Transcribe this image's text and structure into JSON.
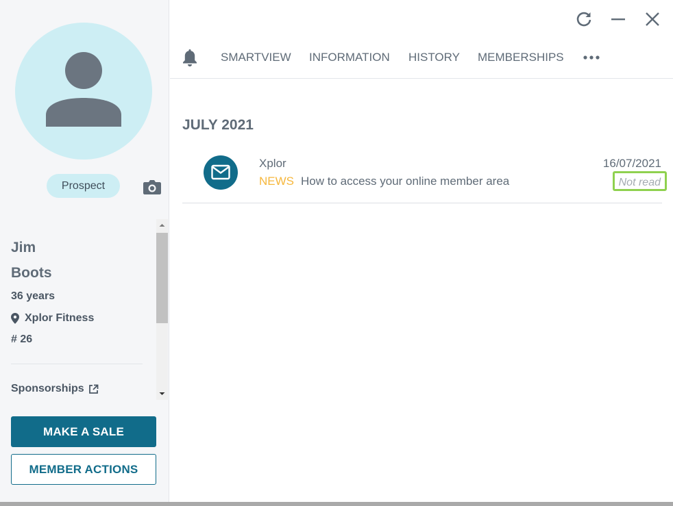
{
  "profile": {
    "status_badge": "Prospect",
    "first_name": "Jim",
    "last_name": "Boots",
    "age": "36 years",
    "location": "Xplor Fitness",
    "member_number": "# 26",
    "sponsorships_label": "Sponsorships"
  },
  "actions": {
    "make_sale": "MAKE A SALE",
    "member_actions": "MEMBER ACTIONS"
  },
  "tabs": [
    {
      "label": "SMARTVIEW"
    },
    {
      "label": "INFORMATION"
    },
    {
      "label": "HISTORY"
    },
    {
      "label": "MEMBERSHIPS"
    }
  ],
  "icons": {
    "refresh": "refresh-icon",
    "minimize": "minimize-icon",
    "close": "close-icon",
    "notifications": "bell-icon",
    "more": "more-icon",
    "message": "envelope-icon",
    "camera": "camera-icon",
    "location": "location-pin-icon",
    "external_link": "external-link-icon"
  },
  "colors": {
    "primary": "#116c8a",
    "avatar_bg": "#cdeef4",
    "category": "#f6b73c",
    "highlight": "#8fd14f"
  },
  "messages": {
    "month_heading": "JULY 2021",
    "items": [
      {
        "sender": "Xplor",
        "category": "NEWS",
        "subject": "How to access your online member area",
        "date": "16/07/2021",
        "status": "Not read"
      }
    ]
  }
}
